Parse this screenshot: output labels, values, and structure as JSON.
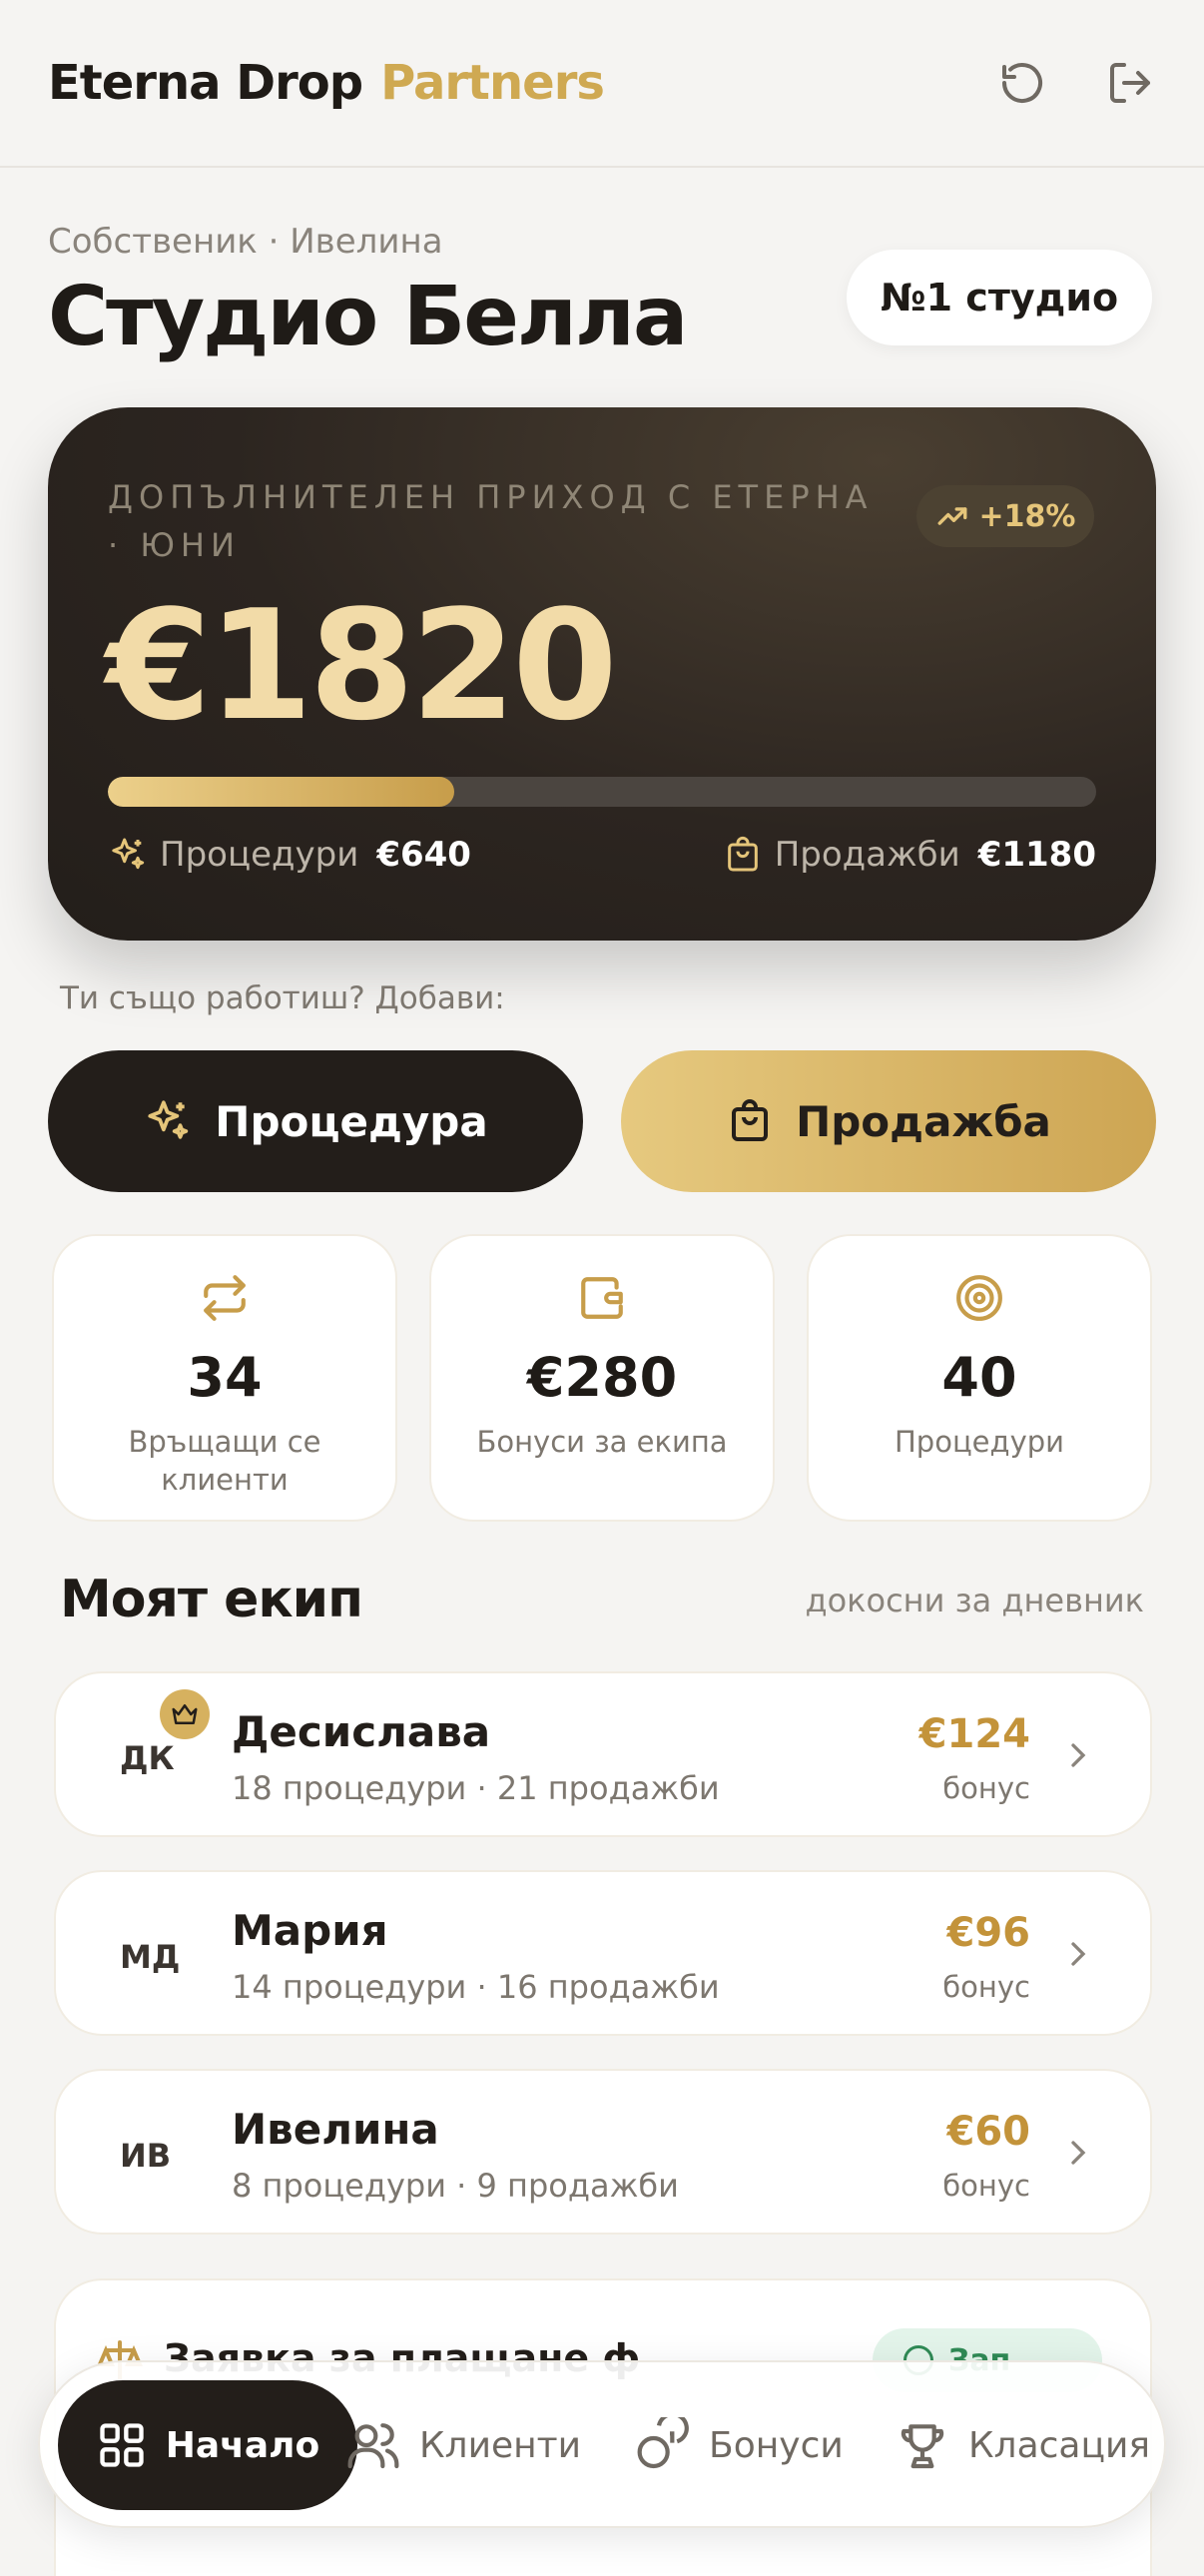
{
  "header": {
    "brand_main": "Eterna Drop",
    "brand_accent": "Partners",
    "refresh_icon": "refresh-icon",
    "logout_icon": "logout-icon"
  },
  "studio": {
    "owner": "Собственик · Ивелина",
    "name": "Студио Белла",
    "rank": "№1 студио"
  },
  "hero": {
    "label": "ДОПЪЛНИТЕЛЕН ПРИХОД С ЕТЕРНА · ЮНИ",
    "trend": "+18%",
    "amount": "€1820",
    "progress": 0.35,
    "procedures_label": "Процедури",
    "procedures_value": "€640",
    "sales_label": "Продажби",
    "sales_value": "€1180"
  },
  "actions": {
    "prompt": "Ти също работиш? Добави:",
    "procedure_button": "Процедура",
    "sale_button": "Продажба"
  },
  "stats": [
    {
      "icon": "repeat-icon",
      "value": "34",
      "label": "Връщащи се клиенти"
    },
    {
      "icon": "wallet-icon",
      "value": "€280",
      "label": "Бонуси за екипа"
    },
    {
      "icon": "target-icon",
      "value": "40",
      "label": "Процедури"
    }
  ],
  "team": {
    "title": "Моят екип",
    "hint": "докосни за дневник",
    "members": [
      {
        "initials": "ДК",
        "name": "Десислава",
        "summary": "18 процедури · 21 продажби",
        "bonus": "€124",
        "bonus_label": "бонус",
        "top": true
      },
      {
        "initials": "МД",
        "name": "Мария",
        "summary": "14 процедури · 16 продажби",
        "bonus": "€96",
        "bonus_label": "бонус"
      },
      {
        "initials": "ИВ",
        "name": "Ивелина",
        "summary": "8 процедури · 9 продажби",
        "bonus": "€60",
        "bonus_label": "бонус"
      }
    ]
  },
  "peek": {
    "text": "Заявка за плащане ф",
    "pill": "Зап"
  },
  "nav": {
    "items": [
      {
        "label": "Начало",
        "icon": "grid-icon",
        "active": true
      },
      {
        "label": "Клиенти",
        "icon": "users-icon"
      },
      {
        "label": "Бонуси",
        "icon": "coins-icon"
      },
      {
        "label": "Класация",
        "icon": "trophy-icon"
      }
    ]
  },
  "colors": {
    "accent_gold": "#cfa952",
    "dark": "#231e1a",
    "background": "#f5f4f2",
    "success": "#2f8a55"
  }
}
